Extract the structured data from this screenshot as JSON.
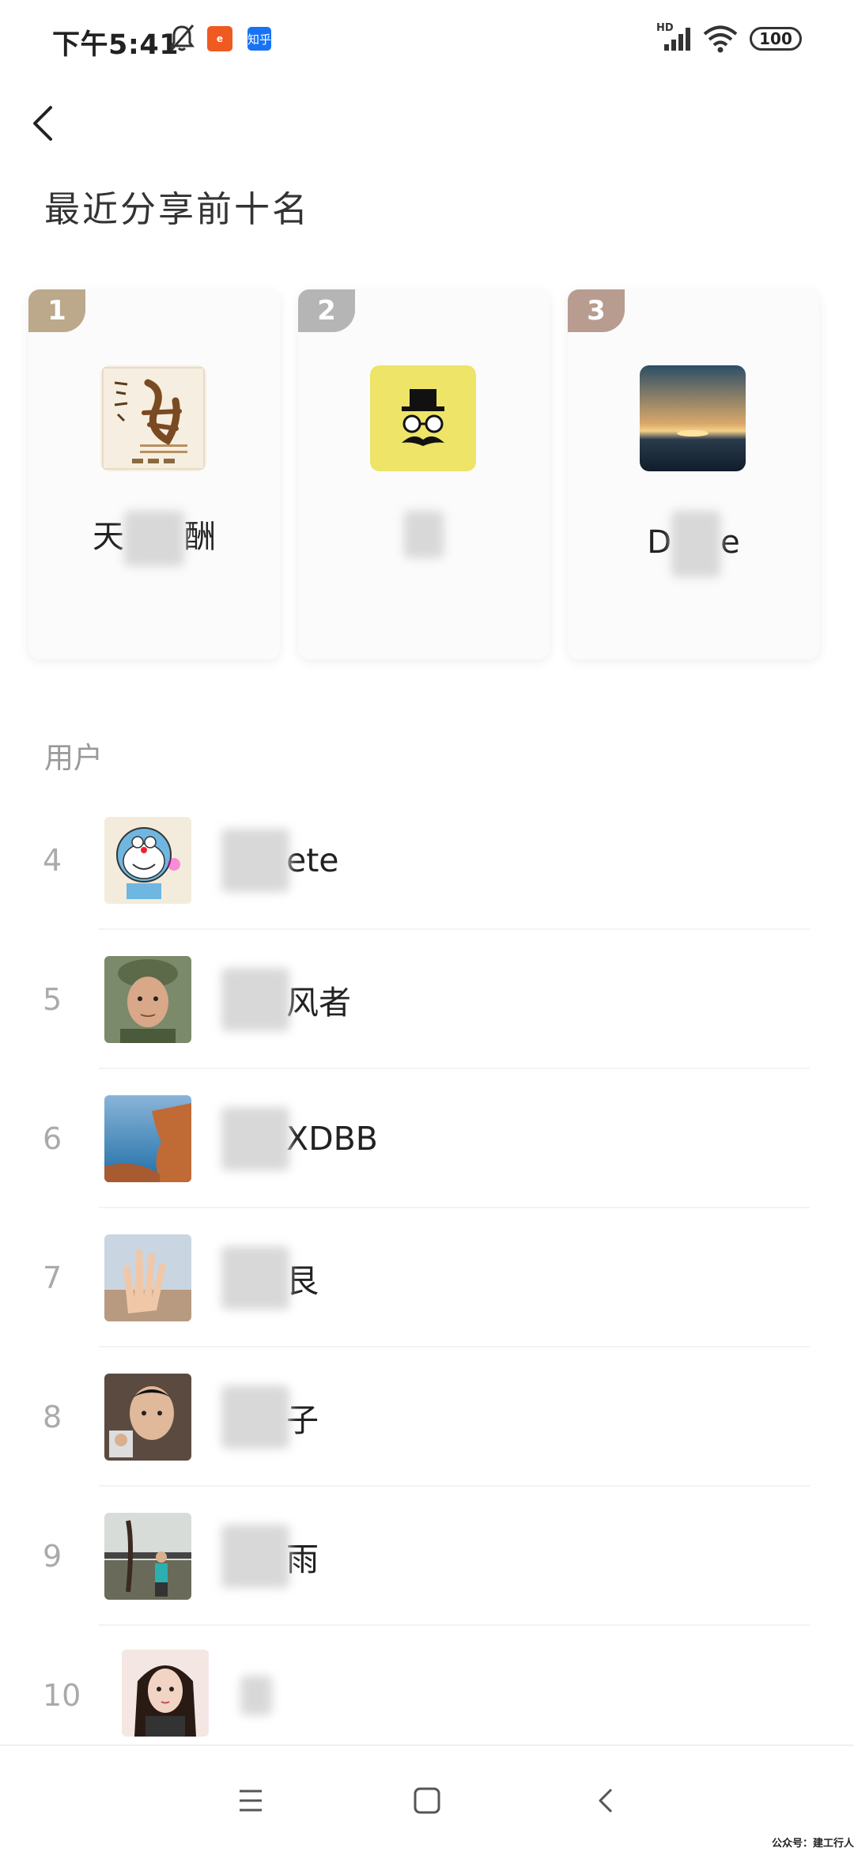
{
  "status_bar": {
    "time": "下午5:41",
    "app1_icon": "taobao-icon",
    "app2_icon": "zhihu-icon",
    "app2_text": "知乎",
    "signal_label": "HD",
    "battery": "100"
  },
  "header": {
    "back_icon": "back-chevron-icon",
    "title": "最近分享前十名"
  },
  "top3": [
    {
      "rank": "1",
      "name_left": "天",
      "name_right": "酬"
    },
    {
      "rank": "2",
      "name_left": "",
      "name_right": ""
    },
    {
      "rank": "3",
      "name_left": "D",
      "name_right": "e"
    }
  ],
  "section": {
    "label": "用户"
  },
  "users": [
    {
      "rank": "4",
      "name_visible": "ete"
    },
    {
      "rank": "5",
      "name_visible": "风者"
    },
    {
      "rank": "6",
      "name_visible": "XDBB"
    },
    {
      "rank": "7",
      "name_visible": "艮"
    },
    {
      "rank": "8",
      "name_visible": "子"
    },
    {
      "rank": "9",
      "name_visible": "雨"
    },
    {
      "rank": "10",
      "name_visible": ""
    }
  ],
  "navbar": {
    "menu_icon": "menu-icon",
    "home_icon": "home-square-icon",
    "back_icon": "back-icon"
  },
  "watermark": "公众号：建工行人",
  "colors": {
    "gold": "#bca88a",
    "silver": "#b5b5b5",
    "bronze": "#b89c8f"
  }
}
